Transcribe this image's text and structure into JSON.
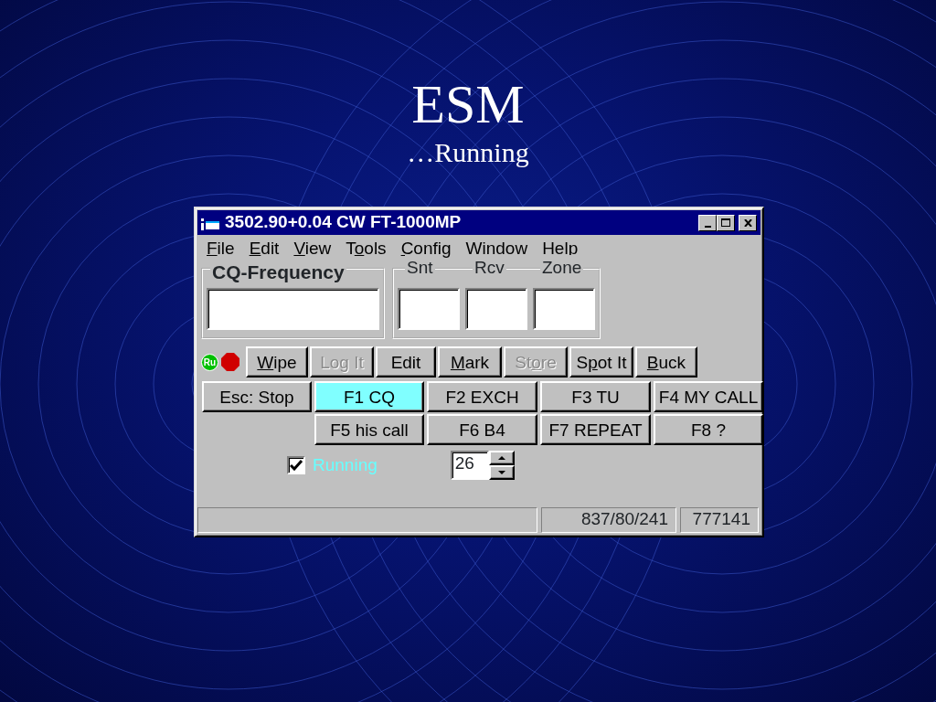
{
  "slide": {
    "title": "ESM",
    "subtitle": "…Running"
  },
  "window": {
    "title": "3502.90+0.04 CW FT-1000MP"
  },
  "menu": [
    {
      "hotkey": "F",
      "label_end": "ile"
    },
    {
      "hotkey": "E",
      "label_end": "dit"
    },
    {
      "hotkey": "V",
      "label_end": "iew"
    },
    {
      "label_start": "T",
      "hotkey": "o",
      "label_end": "ols"
    },
    {
      "hotkey": "C",
      "label_end": "onfig"
    },
    {
      "label_start": "Window"
    },
    {
      "label_start": "Help"
    }
  ],
  "frequency": {
    "label": "CQ-Frequency"
  },
  "exchange_fields": [
    {
      "label": "Snt"
    },
    {
      "label": "Rcv"
    },
    {
      "label": "Zone"
    }
  ],
  "run_badge": "Ru",
  "toolbar": [
    {
      "hotkey": "W",
      "label_end": "ipe",
      "disabled": false
    },
    {
      "label_start": "Log It",
      "disabled": true
    },
    {
      "label_start": "Edit",
      "disabled": false
    },
    {
      "hotkey": "M",
      "label_end": "ark",
      "disabled": false
    },
    {
      "label_start": "St",
      "hotkey": "o",
      "label_end": "re",
      "disabled": true
    },
    {
      "label_start": "S",
      "hotkey": "p",
      "label_end": "ot It",
      "disabled": false
    },
    {
      "hotkey": "B",
      "label_end": "uck",
      "disabled": false
    }
  ],
  "esc_button": {
    "label": "Esc: Stop"
  },
  "function_keys": [
    {
      "label": "F1 CQ",
      "selected": true
    },
    {
      "label": "F2 EXCH",
      "selected": false
    },
    {
      "label": "F3 TU",
      "selected": false
    },
    {
      "label": "F4 MY CALL",
      "selected": false
    },
    {
      "label": "F5 his call",
      "selected": false
    },
    {
      "label": "F6 B4",
      "selected": false
    },
    {
      "label": "F7 REPEAT",
      "selected": false
    },
    {
      "label": "F8 ?",
      "selected": false
    }
  ],
  "running": {
    "label": "Running",
    "checked": true
  },
  "spinner": {
    "value": "26"
  },
  "status_bar": [
    "837/80/241",
    "777141"
  ]
}
